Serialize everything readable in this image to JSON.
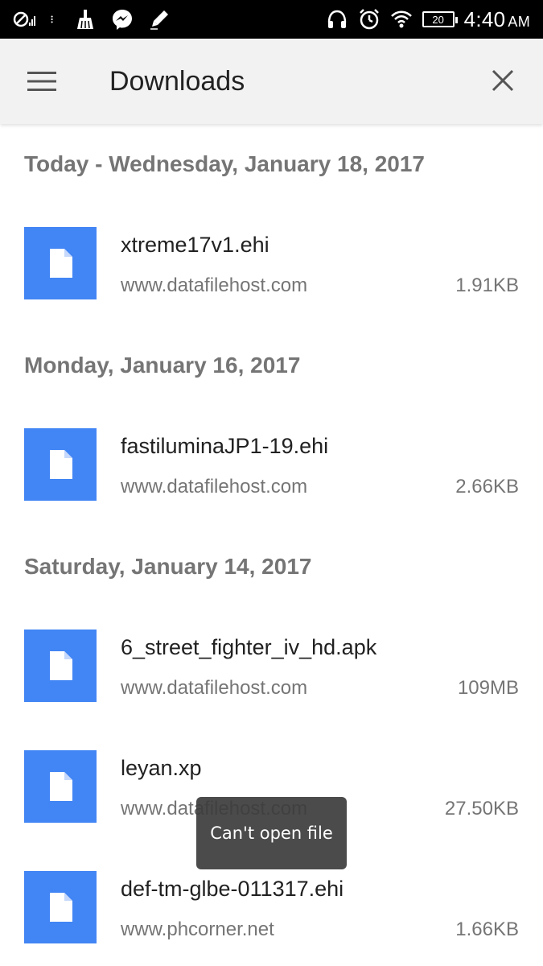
{
  "status_bar": {
    "time": "4:40",
    "ampm": "AM",
    "battery": "20",
    "left_icons": [
      "no-sim-icon",
      "signal-icon",
      "more-icon",
      "broom-icon",
      "messenger-icon",
      "pen-icon"
    ],
    "right_icons": [
      "headset-icon",
      "alarm-icon",
      "wifi-icon",
      "battery-icon"
    ]
  },
  "app_bar": {
    "title": "Downloads",
    "menu_icon": "hamburger-menu-icon",
    "close_icon": "close-icon"
  },
  "colors": {
    "file_thumb": "#4285f4",
    "app_bar_bg": "#f2f2f2",
    "status_bar_bg": "#000000"
  },
  "sections": [
    {
      "header": "Today - Wednesday, January 18, 2017",
      "items": [
        {
          "name": "xtreme17v1.ehi",
          "source": "www.datafilehost.com",
          "size": "1.91KB"
        }
      ]
    },
    {
      "header": "Monday, January 16, 2017",
      "items": [
        {
          "name": "fastiluminaJP1-19.ehi",
          "source": "www.datafilehost.com",
          "size": "2.66KB"
        }
      ]
    },
    {
      "header": "Saturday, January 14, 2017",
      "items": [
        {
          "name": "6_street_fighter_iv_hd.apk",
          "source": "www.datafilehost.com",
          "size": "109MB"
        },
        {
          "name": "leyan.xp",
          "source": "www.datafilehost.com",
          "size": "27.50KB"
        },
        {
          "name": "def-tm-glbe-011317.ehi",
          "source": "www.phcorner.net",
          "size": "1.66KB"
        }
      ]
    }
  ],
  "toast": {
    "message": "Can't open file"
  }
}
